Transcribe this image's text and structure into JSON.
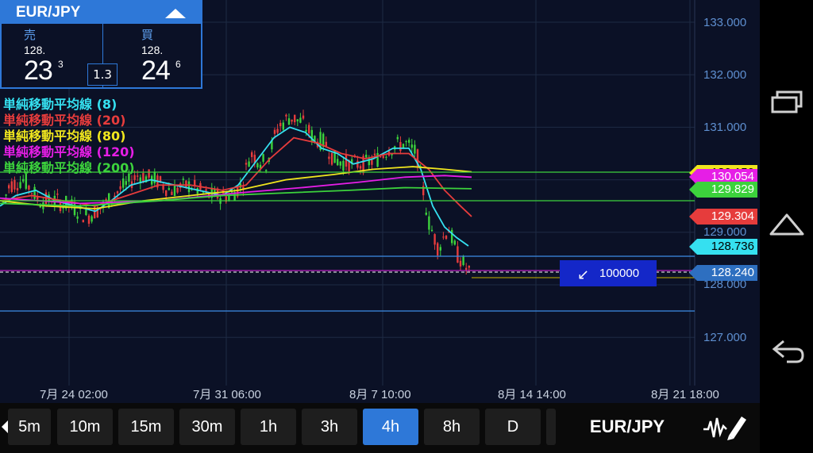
{
  "quote_panel": {
    "pair": "EUR/JPY",
    "sell_label": "売",
    "buy_label": "買",
    "sell_prefix": "128.",
    "sell_main": "23",
    "sell_pip": "3",
    "buy_prefix": "128.",
    "buy_main": "24",
    "buy_pip": "6",
    "spread": "1.3"
  },
  "legend": [
    {
      "label": "単純移動平均線 (8)",
      "color": "#35e0f0"
    },
    {
      "label": "単純移動平均線 (20)",
      "color": "#e63c3c"
    },
    {
      "label": "単純移動平均線 (80)",
      "color": "#f0e61e"
    },
    {
      "label": "単純移動平均線 (120)",
      "color": "#e61ee6"
    },
    {
      "label": "単純移動平均線 (200)",
      "color": "#3cd23c"
    }
  ],
  "price_axis": [
    "133.000",
    "132.000",
    "131.000",
    "129.000",
    "128.000",
    "127.000"
  ],
  "time_axis": [
    "7月 24 02:00",
    "7月 31 06:00",
    "8月 7 10:00",
    "8月 14 14:00",
    "8月 21 18:00"
  ],
  "price_tags": [
    {
      "text": "130.150",
      "bg": "#f0e61e",
      "fg": "#000000"
    },
    {
      "text": "130.054",
      "bg": "#e61ee6",
      "fg": "#ffffff"
    },
    {
      "text": "129.829",
      "bg": "#3cd23c",
      "fg": "#ffffff"
    },
    {
      "text": "129.304",
      "bg": "#e63c3c",
      "fg": "#ffffff"
    },
    {
      "text": "128.736",
      "bg": "#35e0f0",
      "fg": "#000000"
    },
    {
      "text": "128.240",
      "bg": "#2e6fc0",
      "fg": "#ffffff"
    }
  ],
  "order_badge": {
    "icon": "↙",
    "amount": "100000"
  },
  "timeframes": [
    "5m",
    "10m",
    "15m",
    "30m",
    "1h",
    "3h",
    "4h",
    "8h",
    "D"
  ],
  "active_timeframe": "4h",
  "symbol_button": "EUR/JPY",
  "colors": {
    "background": "#0b1126",
    "accent": "#2e78d8",
    "grid": "#1e2a44",
    "up_candle": "#3cd23c",
    "down_candle": "#e63c3c"
  }
}
